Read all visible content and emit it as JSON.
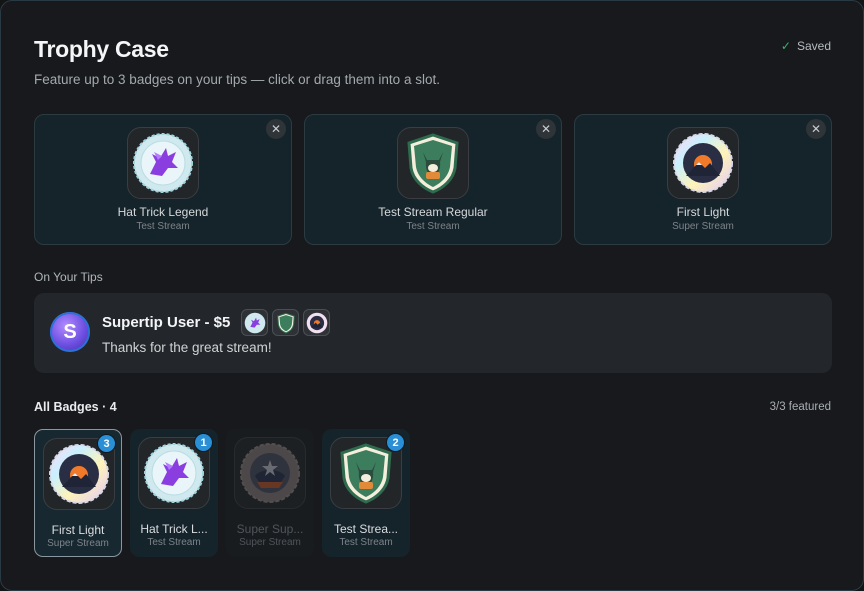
{
  "header": {
    "title": "Trophy Case",
    "subtitle": "Feature up to 3 badges on your tips — click or drag them into a slot.",
    "saved_label": "Saved"
  },
  "slots": [
    {
      "name": "Hat Trick Legend",
      "source": "Test Stream",
      "icon": "pegasus-badge-icon"
    },
    {
      "name": "Test Stream Regular",
      "source": "Test Stream",
      "icon": "fox-shield-badge-icon"
    },
    {
      "name": "First Light",
      "source": "Super Stream",
      "icon": "sunrise-mountain-badge-icon"
    }
  ],
  "tips_section": {
    "label": "On Your Tips",
    "user": "Supertip User - $5",
    "message": "Thanks for the great stream!",
    "avatar_letter": "S"
  },
  "all_badges": {
    "label": "All Badges · 4",
    "featured": "3/3 featured",
    "items": [
      {
        "name": "First Light",
        "source": "Super Stream",
        "slot_number": "3"
      },
      {
        "name": "Hat Trick L...",
        "source": "Test Stream",
        "slot_number": "1"
      },
      {
        "name": "Super Sup...",
        "source": "Super Stream",
        "slot_number": ""
      },
      {
        "name": "Test Strea...",
        "source": "Test Stream",
        "slot_number": "2"
      }
    ]
  },
  "colors": {
    "accent": "#2a8fd4",
    "success": "#3bb36a",
    "background": "#17191c"
  }
}
